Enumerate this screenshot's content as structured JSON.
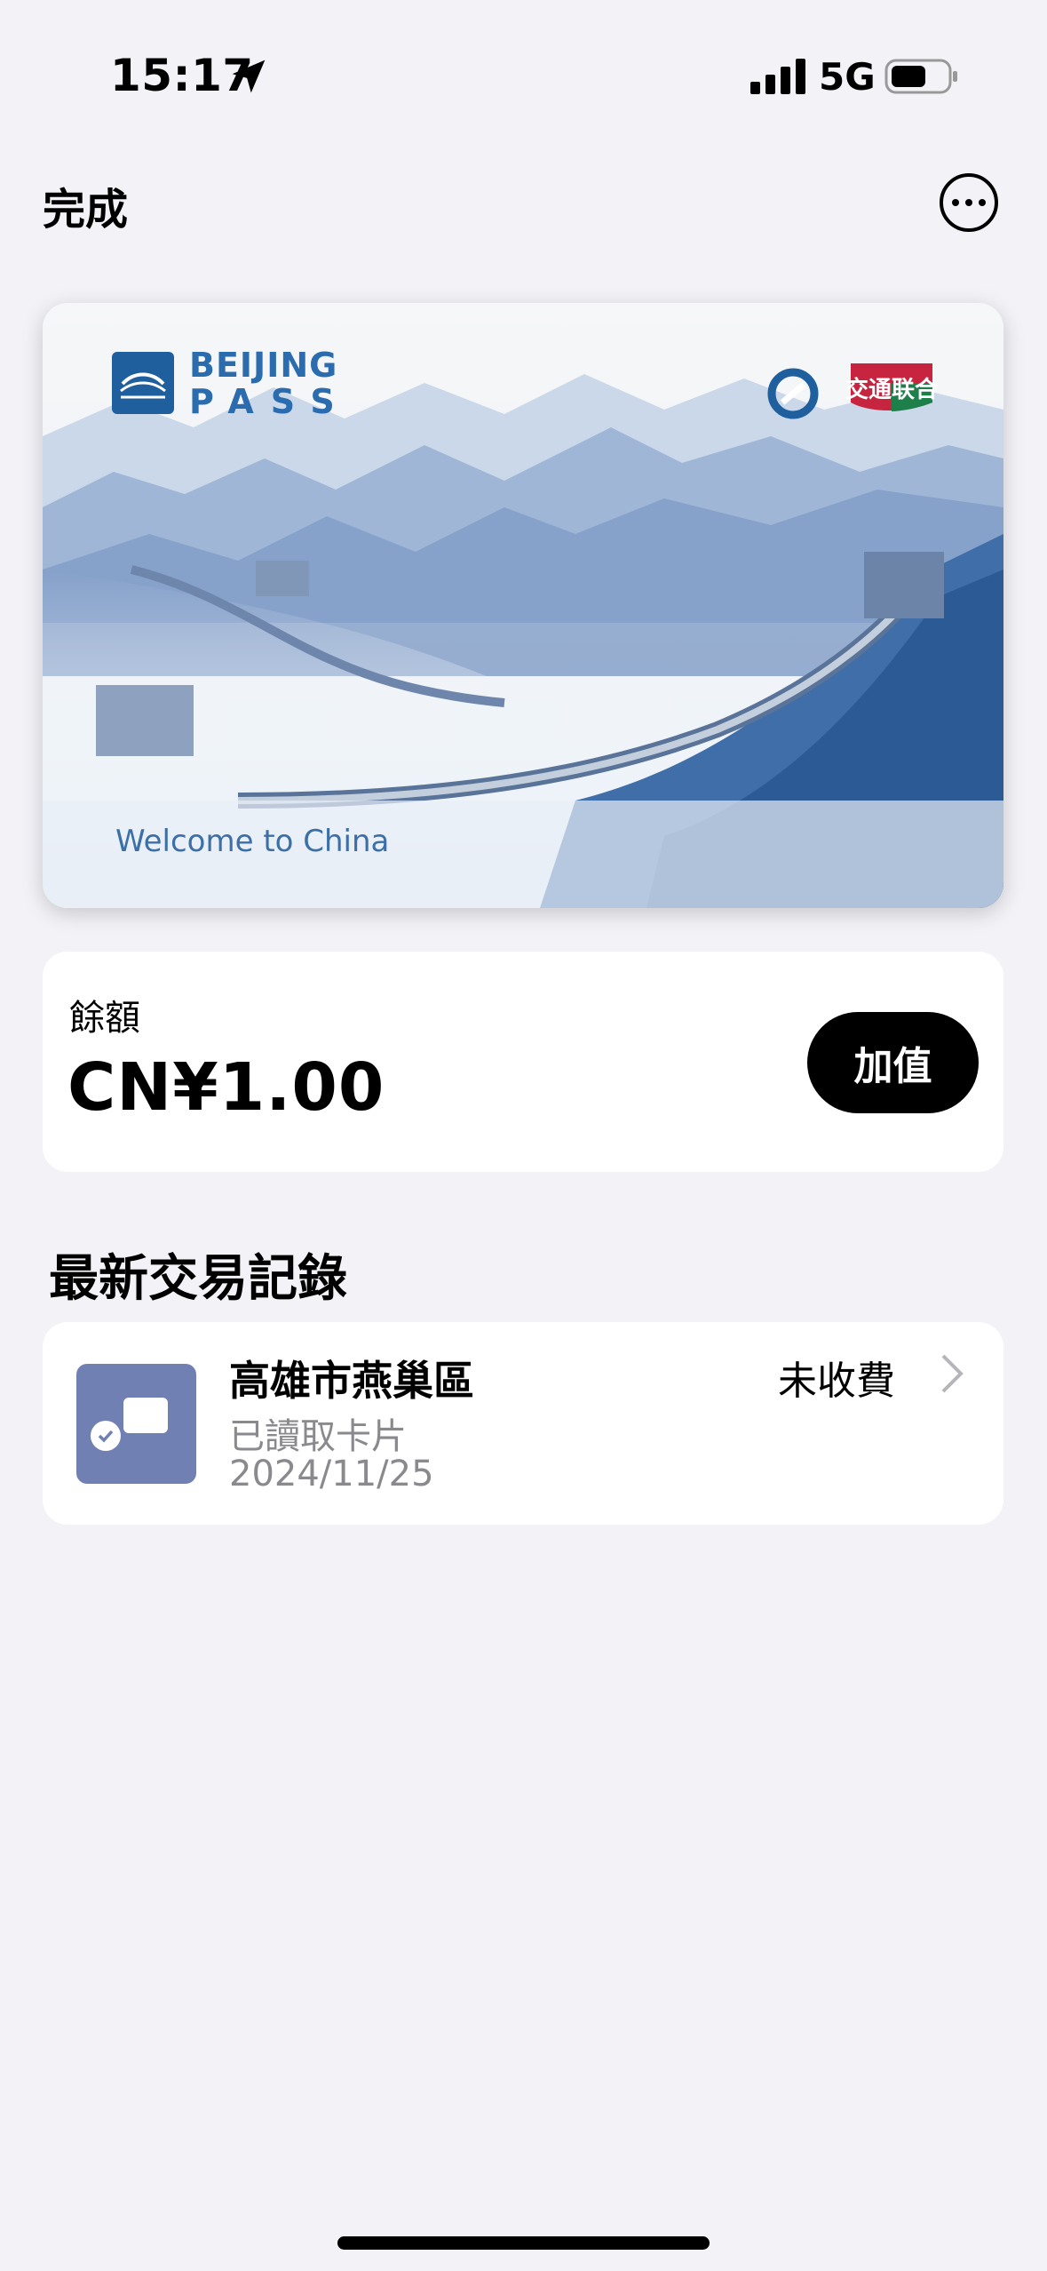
{
  "status_bar": {
    "time": "15:17",
    "network": "5G"
  },
  "nav": {
    "done_label": "完成"
  },
  "card": {
    "brand_line1": "BEIJING",
    "brand_line2": "PASS",
    "partner_text": "交通联合",
    "welcome_text": "Welcome to China"
  },
  "balance": {
    "label": "餘額",
    "value": "CN¥1.00",
    "topup_label": "加值"
  },
  "transactions": {
    "section_title": "最新交易記錄",
    "items": [
      {
        "location": "高雄市燕巢區",
        "description": "已讀取卡片",
        "date": "2024/11/25",
        "status": "未收費"
      }
    ]
  },
  "colors": {
    "accent": "#2a6cae",
    "background": "#f2f2f7",
    "icon_bg": "#7180b3"
  }
}
